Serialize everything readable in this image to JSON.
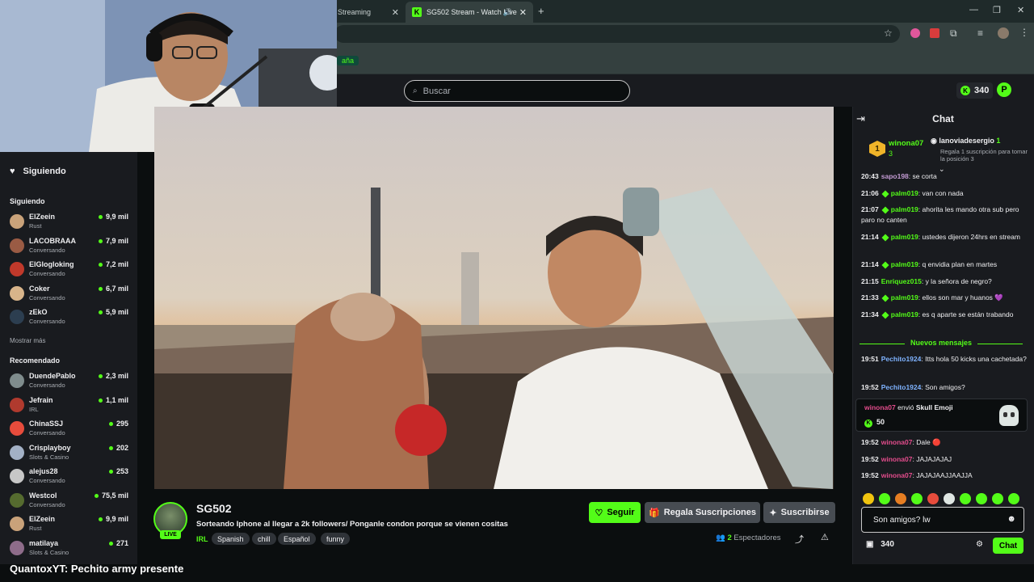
{
  "browser": {
    "tab1_label": "Streaming",
    "tab2_label": "SG502 Stream - Watch Live",
    "tab2_icon": "kick-logo",
    "bookmark_partial": "aña"
  },
  "header": {
    "search_placeholder": "Buscar",
    "coins": "340",
    "p_badge": "P"
  },
  "sidebar": {
    "following_label": "Siguiendo",
    "following_section": "Siguiendo",
    "following": [
      {
        "name": "ElZeein",
        "category": "Rust",
        "viewers": "9,9 mil",
        "color": "#c9a27a"
      },
      {
        "name": "LACOBRAAA",
        "category": "Conversando",
        "viewers": "7,9 mil",
        "color": "#9a5b44"
      },
      {
        "name": "ElGlogloking",
        "category": "Conversando",
        "viewers": "7,2 mil",
        "color": "#c0392b"
      },
      {
        "name": "Coker",
        "category": "Conversando",
        "viewers": "6,7 mil",
        "color": "#d8b48a"
      },
      {
        "name": "zEkO",
        "category": "Conversando",
        "viewers": "5,9 mil",
        "color": "#2c3e50"
      }
    ],
    "show_more": "Mostrar más",
    "recommended_section": "Recomendado",
    "recommended": [
      {
        "name": "DuendePablo",
        "category": "Conversando",
        "viewers": "2,3 mil",
        "color": "#7f8c8d"
      },
      {
        "name": "Jefrain",
        "category": "IRL",
        "viewers": "1,1 mil",
        "color": "#b03a2e"
      },
      {
        "name": "ChinaSSJ",
        "category": "Conversando",
        "viewers": "295",
        "color": "#e74c3c"
      },
      {
        "name": "Crisplayboy",
        "category": "Slots & Casino",
        "viewers": "202",
        "color": "#a3b1c6"
      },
      {
        "name": "alejus28",
        "category": "Conversando",
        "viewers": "253",
        "color": "#c7c7c7"
      },
      {
        "name": "Westcol",
        "category": "Conversando",
        "viewers": "75,5 mil",
        "color": "#556b2f"
      },
      {
        "name": "ElZeein",
        "category": "Rust",
        "viewers": "9,9 mil",
        "color": "#c9a27a"
      },
      {
        "name": "matilaya",
        "category": "Slots & Casino",
        "viewers": "271",
        "color": "#8e6c8a"
      }
    ]
  },
  "stream": {
    "channel": "SG502",
    "live": "LIVE",
    "title": "Sorteando Iphone al llegar a 2k followers/ Ponganle condon porque se vienen cositas",
    "category": "IRL",
    "tags": [
      "Spanish",
      "chill",
      "Español",
      "funny"
    ],
    "follow_label": "Seguir",
    "gift_label": "Regala Suscripciones",
    "subscribe_label": "Suscribirse",
    "viewers_count": "2",
    "viewers_label": "Espectadores"
  },
  "chat": {
    "title": "Chat",
    "pinned": {
      "rank": "1",
      "user": "winona07",
      "count": "3",
      "user2": "lanoviadesergio",
      "count2": "1",
      "promo": "Regala 1 suscripción para tomar la posición 3"
    },
    "messages": [
      {
        "time": "20:43",
        "user": "sapo198",
        "text": "se corta",
        "color": "#c39bd3",
        "badge": false
      },
      {
        "time": "21:06",
        "user": "palm019",
        "text": "van con nada",
        "color": "#53fc18",
        "badge": true
      },
      {
        "time": "21:07",
        "user": "palm019",
        "text": "ahorita les mando otra sub pero paro no canten",
        "color": "#53fc18",
        "badge": true
      },
      {
        "time": "21:14",
        "user": "palm019",
        "text": "ustedes dijeron 24hrs en stream",
        "color": "#53fc18",
        "badge": true
      },
      {
        "time": "21:14",
        "user": "palm019",
        "text": "q envidia plan en martes",
        "color": "#53fc18",
        "badge": true
      },
      {
        "time": "21:15",
        "user": "Enriquez015",
        "text": "y la señora de negro?",
        "color": "#53fc18",
        "badge": false
      },
      {
        "time": "21:33",
        "user": "palm019",
        "text": "ellos son mar y huanos 💜",
        "color": "#53fc18",
        "badge": true
      },
      {
        "time": "21:34",
        "user": "palm019",
        "text": "es q aparte se están trabando",
        "color": "#53fc18",
        "badge": true
      }
    ],
    "new_messages_label": "Nuevos mensajes",
    "new_messages": [
      {
        "time": "19:51",
        "user": "Pechito1924",
        "text": "Itts hola 50 kicks una cachetada?",
        "color": "#7fb3ff"
      },
      {
        "time": "19:52",
        "user": "Pechito1924",
        "text": "Son amigos?",
        "color": "#7fb3ff"
      }
    ],
    "gift": {
      "user": "winona07",
      "action": "envió",
      "item": "Skull Emoji",
      "amount": "50"
    },
    "after_gift": [
      {
        "time": "19:52",
        "user": "winona07",
        "text": "Dale 🔴",
        "color": "#e34c8c"
      },
      {
        "time": "19:52",
        "user": "winona07",
        "text": "JAJAJAJAJ",
        "color": "#e34c8c"
      },
      {
        "time": "19:52",
        "user": "winona07",
        "text": "JAJAJAAJJAAJJA",
        "color": "#e34c8c"
      }
    ],
    "input_value": "Son amigos? lw",
    "balance": "340",
    "send_label": "Chat"
  },
  "overlay": {
    "caption_user": "QuantoxYT",
    "caption_text": ": Pechito army presente"
  },
  "colors": {
    "accent": "#53fc18",
    "bg": "#0b0e0f",
    "panel": "#191b1f"
  }
}
